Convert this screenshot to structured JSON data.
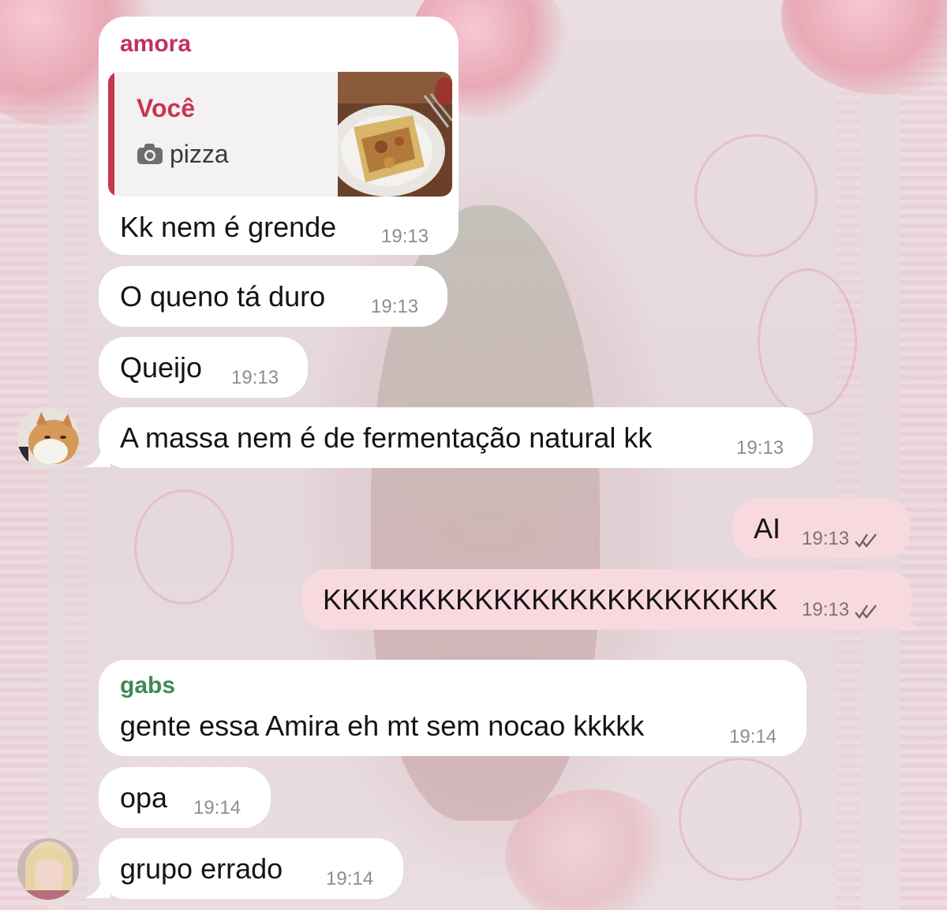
{
  "colors": {
    "incoming_bubble": "#ffffff",
    "outgoing_bubble": "#f8d9df",
    "sender_amora": "#c0325a",
    "sender_gabs": "#3f8a55",
    "reply_accent": "#c93552"
  },
  "messages": [
    {
      "sender": "amora",
      "reply": {
        "author": "Você",
        "icon": "camera-icon",
        "text": "pizza",
        "thumb": "pizza-photo"
      },
      "text": "Kk nem é grende",
      "time": "19:13"
    },
    {
      "text": "O queno tá duro",
      "time": "19:13"
    },
    {
      "text": "Queijo",
      "time": "19:13"
    },
    {
      "text": "A massa nem é de fermentação natural kk",
      "time": "19:13",
      "avatar": "cat-avatar"
    },
    {
      "text": "AI",
      "time": "19:13",
      "outgoing": true,
      "status": "read"
    },
    {
      "text": "KKKKKKKKKKKKKKKKKKKKKKKK",
      "time": "19:13",
      "outgoing": true,
      "status": "read"
    },
    {
      "sender": "gabs",
      "text": "gente essa Amira eh mt sem nocao kkkkk",
      "time": "19:14"
    },
    {
      "text": "opa",
      "time": "19:14"
    },
    {
      "text": "grupo errado",
      "time": "19:14",
      "avatar": "girl-avatar"
    }
  ]
}
